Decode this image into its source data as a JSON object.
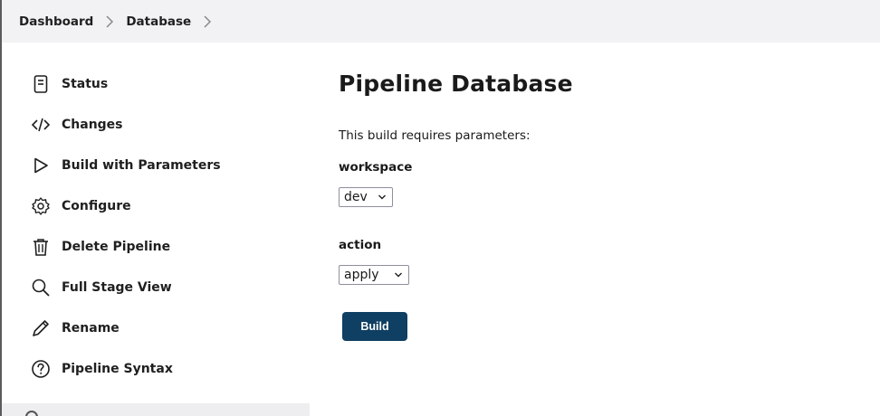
{
  "breadcrumb": {
    "items": [
      {
        "label": "Dashboard"
      },
      {
        "label": "Database"
      }
    ]
  },
  "sidebar": {
    "items": [
      {
        "label": "Status",
        "icon": "document-icon"
      },
      {
        "label": "Changes",
        "icon": "code-icon"
      },
      {
        "label": "Build with Parameters",
        "icon": "play-icon"
      },
      {
        "label": "Configure",
        "icon": "gear-icon"
      },
      {
        "label": "Delete Pipeline",
        "icon": "trash-icon"
      },
      {
        "label": "Full Stage View",
        "icon": "search-icon"
      },
      {
        "label": "Rename",
        "icon": "pencil-icon"
      },
      {
        "label": "Pipeline Syntax",
        "icon": "help-circle-icon"
      }
    ]
  },
  "main": {
    "title": "Pipeline Database",
    "intro": "This build requires parameters:",
    "params": [
      {
        "name": "workspace",
        "selected": "dev"
      },
      {
        "name": "action",
        "selected": "apply"
      }
    ],
    "build_label": "Build"
  },
  "colors": {
    "breadcrumb_bg": "#f2f2f4",
    "build_button_bg": "#0f3f62",
    "sidebar_bottom_bg": "#eeeef1"
  }
}
